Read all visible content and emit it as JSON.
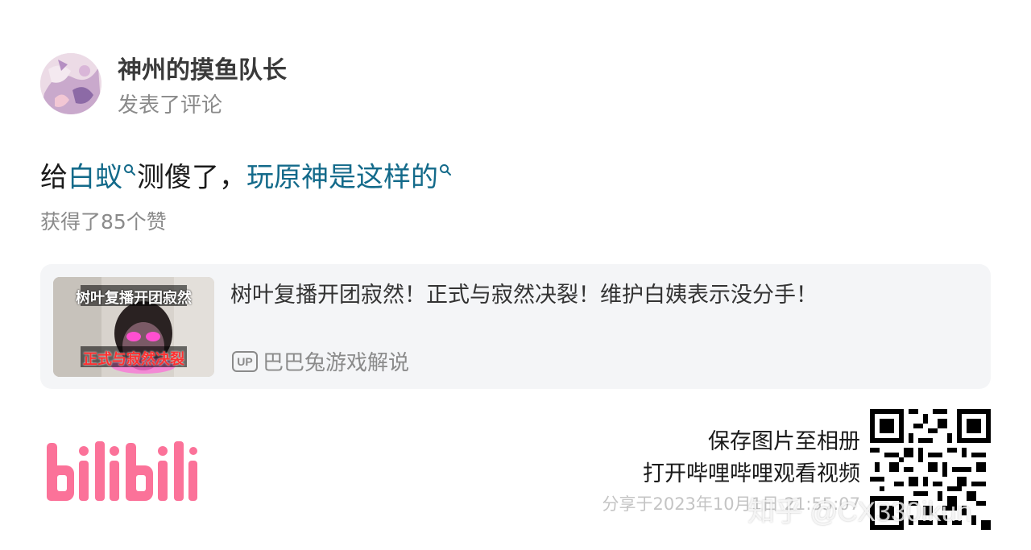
{
  "user": {
    "name": "神州的摸鱼队长",
    "action": "发表了评论"
  },
  "comment": {
    "part1_link": "白蚁",
    "part1_prefix": "给",
    "part2_text": "测傻了，",
    "part3_link": "玩原神是这样的"
  },
  "likes_text": "获得了85个赞",
  "video": {
    "title": "树叶复播开团寂然！正式与寂然决裂！维护白姨表示没分手！",
    "uploader_badge": "UP",
    "uploader": "巴巴兔游戏解说",
    "thumb_top_text": "树叶复播开团寂然",
    "thumb_bottom_text": "正式与寂然决裂"
  },
  "logo_text": "bilibili",
  "cta_line1": "保存图片至相册",
  "cta_line2": "打开哔哩哔哩观看视频",
  "share_time": "分享于2023年10月1日 21:55:07",
  "watermark": "知乎 @CX330ikun",
  "colors": {
    "link": "#136a8a",
    "brand_pink": "#fb7299",
    "card_bg": "#f4f5f7"
  }
}
